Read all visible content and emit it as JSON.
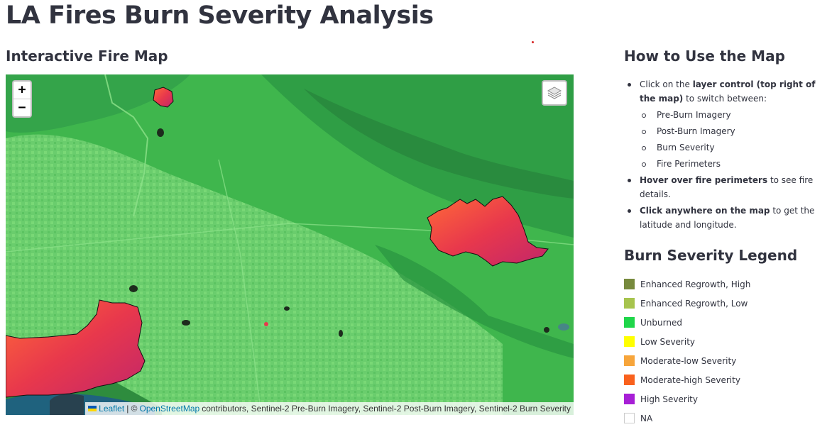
{
  "page_title": "LA Fires Burn Severity Analysis",
  "map_section": {
    "title": "Interactive Fire Map",
    "zoom_in_label": "+",
    "zoom_out_label": "−",
    "layers_icon": "layers-icon",
    "attribution": {
      "leaflet": "Leaflet",
      "separator": "| ©",
      "osm": "OpenStreetMap",
      "rest": "contributors, Sentinel-2 Pre-Burn Imagery, Sentinel-2 Post-Burn Imagery, Sentinel-2 Burn Severity"
    }
  },
  "howto": {
    "title": "How to Use the Map",
    "item1_prefix": "Click on the ",
    "item1_bold": "layer control (top right of the map)",
    "item1_suffix": " to switch between:",
    "layers": [
      "Pre-Burn Imagery",
      "Post-Burn Imagery",
      "Burn Severity",
      "Fire Perimeters"
    ],
    "item2_bold": "Hover over fire perimeters",
    "item2_suffix": " to see fire details.",
    "item3_bold": "Click anywhere on the map",
    "item3_suffix": " to get the latitude and longitude."
  },
  "legend": {
    "title": "Burn Severity Legend",
    "items": [
      {
        "label": "Enhanced Regrowth, High",
        "color": "#778a3d"
      },
      {
        "label": "Enhanced Regrowth, Low",
        "color": "#a7c44e"
      },
      {
        "label": "Unburned",
        "color": "#1fd64a"
      },
      {
        "label": "Low Severity",
        "color": "#ffff00"
      },
      {
        "label": "Moderate-low Severity",
        "color": "#f7a53b"
      },
      {
        "label": "Moderate-high Severity",
        "color": "#f9611d"
      },
      {
        "label": "High Severity",
        "color": "#a71fd6"
      },
      {
        "label": "NA",
        "color": "#ffffff"
      }
    ]
  }
}
